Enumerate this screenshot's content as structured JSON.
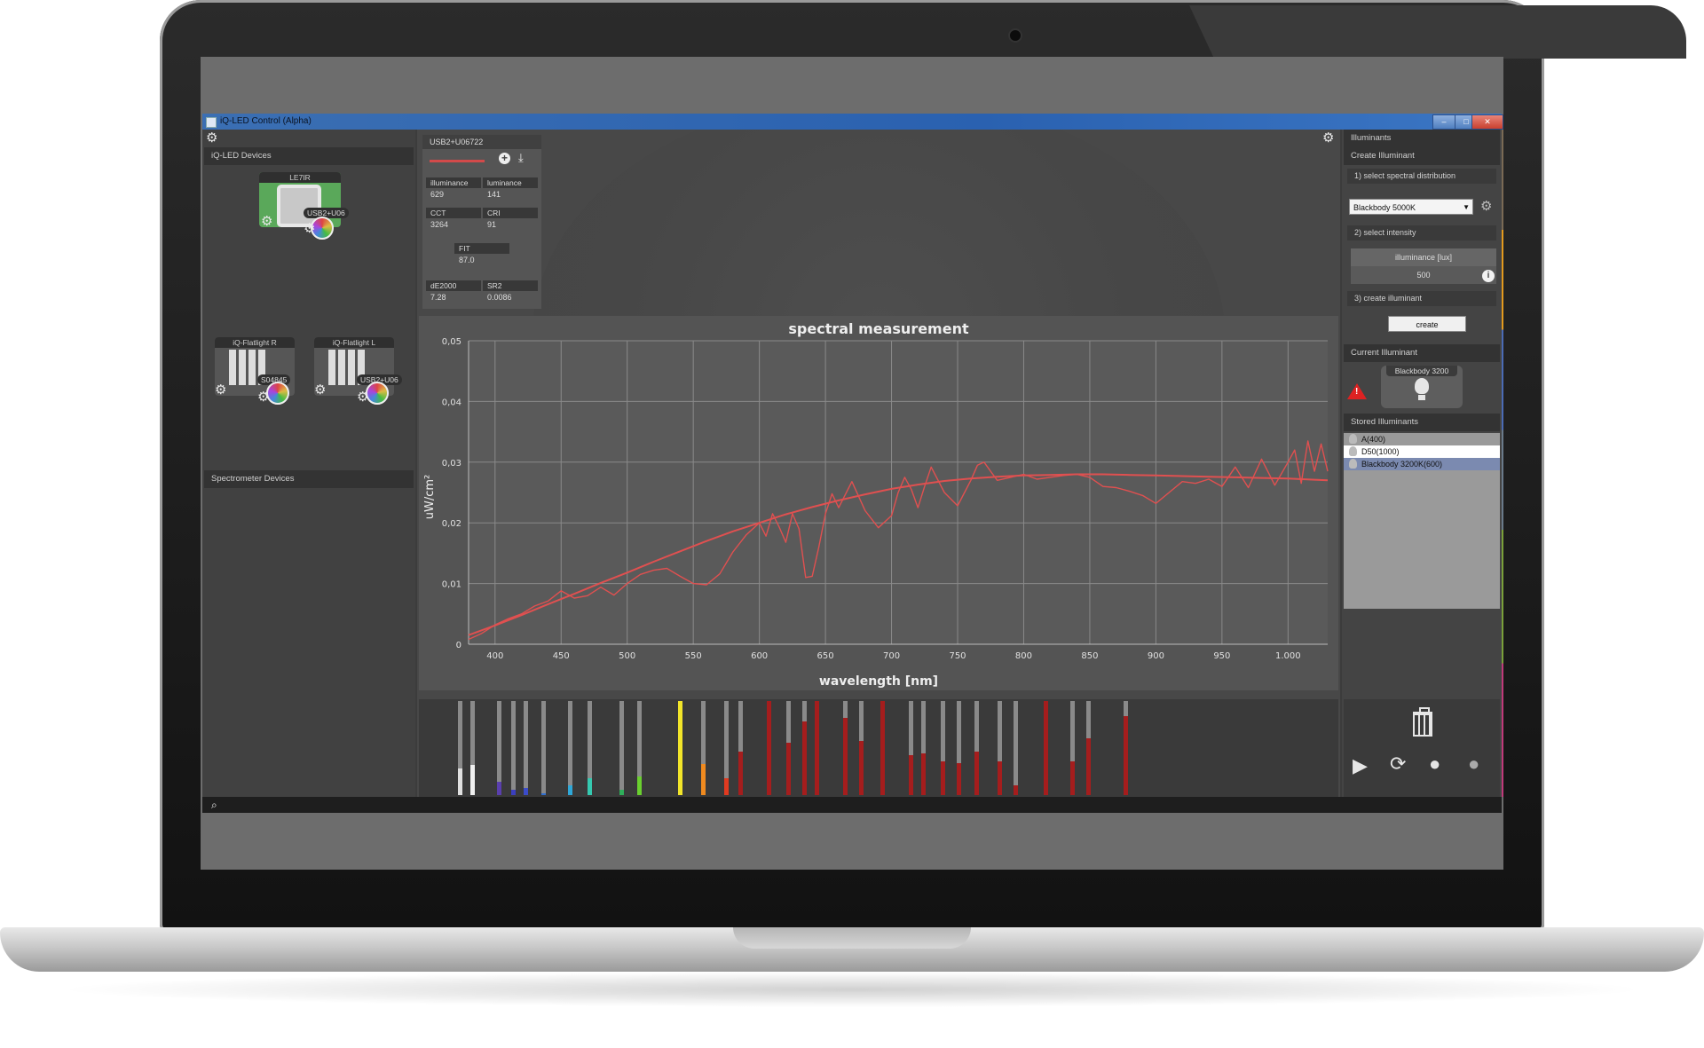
{
  "window": {
    "title": "iQ-LED Control (Alpha)",
    "minimize": "–",
    "maximize": "□",
    "close": "✕"
  },
  "left": {
    "devices_header": "iQ-LED Devices",
    "spectrometer_header": "Spectrometer Devices",
    "devices": [
      {
        "label": "LE7IR",
        "badge": "USB2+U06"
      },
      {
        "label": "iQ-Flatlight R",
        "badge": "S04845"
      },
      {
        "label": "iQ-Flatlight L",
        "badge": "USB2+U06"
      }
    ]
  },
  "measurement": {
    "device": "USB2+U06722",
    "cells": [
      {
        "k": "illuminance",
        "v": "629"
      },
      {
        "k": "luminance",
        "v": "141"
      },
      {
        "k": "CCT",
        "v": "3264"
      },
      {
        "k": "CRI",
        "v": "91"
      },
      {
        "k": "FIT",
        "v": "87.0"
      },
      {
        "k": "dE2000",
        "v": "7.28"
      },
      {
        "k": "SR2",
        "v": "0.0086"
      }
    ]
  },
  "chart_data": {
    "type": "line",
    "title": "spectral measurement",
    "xlabel": "wavelength [nm]",
    "ylabel": "uW/cm²",
    "xlim": [
      380,
      1030
    ],
    "ylim": [
      0,
      0.05
    ],
    "x_ticks": [
      400,
      450,
      500,
      550,
      600,
      650,
      700,
      750,
      800,
      850,
      900,
      950,
      1000
    ],
    "x_tick_labels": [
      "400",
      "450",
      "500",
      "550",
      "600",
      "650",
      "700",
      "750",
      "800",
      "850",
      "900",
      "950",
      "1.000"
    ],
    "y_ticks": [
      0,
      0.01,
      0.02,
      0.03,
      0.04,
      0.05
    ],
    "y_tick_labels": [
      "0",
      "0,01",
      "0,02",
      "0,03",
      "0,04",
      "0,05"
    ],
    "grid": true,
    "line_color": "#e05050",
    "series": [
      {
        "x": [
          380,
          400,
          420,
          440,
          460,
          480,
          500,
          520,
          540,
          560,
          580,
          600,
          620,
          640,
          660,
          680,
          700,
          720,
          740,
          760,
          780,
          800,
          820,
          840,
          860,
          880,
          900,
          920,
          940,
          960,
          980,
          1000,
          1020,
          1030
        ],
        "y": [
          0.0015,
          0.0031,
          0.0048,
          0.0066,
          0.0083,
          0.0101,
          0.0118,
          0.0136,
          0.0153,
          0.017,
          0.0186,
          0.02,
          0.0214,
          0.0226,
          0.0237,
          0.0247,
          0.0256,
          0.0263,
          0.0269,
          0.0273,
          0.0276,
          0.0278,
          0.0279,
          0.028,
          0.028,
          0.0279,
          0.0278,
          0.0277,
          0.0276,
          0.0275,
          0.0274,
          0.0273,
          0.0271,
          0.027
        ]
      },
      {
        "x": [
          380,
          390,
          400,
          410,
          420,
          430,
          440,
          450,
          460,
          470,
          480,
          490,
          500,
          510,
          520,
          530,
          540,
          550,
          560,
          570,
          580,
          590,
          600,
          605,
          610,
          615,
          620,
          625,
          630,
          635,
          640,
          645,
          650,
          655,
          660,
          670,
          680,
          690,
          700,
          705,
          710,
          715,
          720,
          725,
          730,
          740,
          750,
          760,
          765,
          770,
          775,
          780,
          790,
          800,
          810,
          820,
          830,
          840,
          850,
          860,
          870,
          880,
          890,
          900,
          910,
          920,
          930,
          940,
          950,
          960,
          970,
          980,
          990,
          1000,
          1005,
          1010,
          1015,
          1020,
          1025,
          1030
        ],
        "y": [
          0.0008,
          0.0018,
          0.0032,
          0.0042,
          0.005,
          0.0063,
          0.0071,
          0.0088,
          0.0076,
          0.008,
          0.0094,
          0.0081,
          0.01,
          0.0115,
          0.0122,
          0.0125,
          0.0112,
          0.01,
          0.0098,
          0.0116,
          0.0152,
          0.018,
          0.02,
          0.0178,
          0.0215,
          0.0193,
          0.0168,
          0.0215,
          0.019,
          0.011,
          0.0112,
          0.016,
          0.0215,
          0.0248,
          0.0225,
          0.0268,
          0.022,
          0.0192,
          0.0212,
          0.025,
          0.0275,
          0.0255,
          0.0225,
          0.026,
          0.0292,
          0.025,
          0.0228,
          0.027,
          0.0295,
          0.03,
          0.0285,
          0.027,
          0.0275,
          0.028,
          0.0272,
          0.0275,
          0.0278,
          0.028,
          0.0275,
          0.026,
          0.0258,
          0.0252,
          0.0245,
          0.0232,
          0.025,
          0.0268,
          0.0265,
          0.0272,
          0.026,
          0.0292,
          0.0258,
          0.0305,
          0.0262,
          0.03,
          0.032,
          0.0265,
          0.0335,
          0.0285,
          0.033,
          0.0285
        ]
      }
    ]
  },
  "led_channels": [
    {
      "color": "#e0e0e0",
      "level": 0.28
    },
    {
      "color": "#f0f0f0",
      "level": 0.32
    },
    {
      "color": "#5a3fae",
      "level": 0.14
    },
    {
      "color": "#3b3fbf",
      "level": 0.06
    },
    {
      "color": "#3b4cc9",
      "level": 0.08
    },
    {
      "color": "#2f6fd0",
      "level": 0.02
    },
    {
      "color": "#2fa8d8",
      "level": 0.1
    },
    {
      "color": "#35c9b0",
      "level": 0.18
    },
    {
      "color": "#2fae5a",
      "level": 0.06
    },
    {
      "color": "#6ad02f",
      "level": 0.2
    },
    {
      "color": "#f2e52a",
      "level": 1.0
    },
    {
      "color": "#f08a1f",
      "level": 0.33
    },
    {
      "color": "#e03a20",
      "level": 0.18
    },
    {
      "color": "#a51d1d",
      "level": 0.46
    },
    {
      "color": "#a51d1d",
      "level": 1.0
    },
    {
      "color": "#a51d1d",
      "level": 0.56
    },
    {
      "color": "#a51d1d",
      "level": 0.78
    },
    {
      "color": "#a51d1d",
      "level": 1.0
    },
    {
      "color": "#a51d1d",
      "level": 0.82
    },
    {
      "color": "#a51d1d",
      "level": 0.58
    },
    {
      "color": "#a51d1d",
      "level": 1.0
    },
    {
      "color": "#a51d1d",
      "level": 0.42
    },
    {
      "color": "#a51d1d",
      "level": 0.44
    },
    {
      "color": "#a51d1d",
      "level": 0.36
    },
    {
      "color": "#a51d1d",
      "level": 0.34
    },
    {
      "color": "#a51d1d",
      "level": 0.46
    },
    {
      "color": "#a51d1d",
      "level": 0.36
    },
    {
      "color": "#a51d1d",
      "level": 0.1
    },
    {
      "color": "#a51d1d",
      "level": 1.0
    },
    {
      "color": "#a51d1d",
      "level": 0.36
    },
    {
      "color": "#a51d1d",
      "level": 0.6
    },
    {
      "color": "#a51d1d",
      "level": 0.84
    }
  ],
  "right": {
    "header": "Illuminants",
    "create_header": "Create Illuminant",
    "step1": "1) select spectral distribution",
    "spectral_select": "Blackbody 5000K",
    "step2": "2) select intensity",
    "intensity_label": "illuminance [lux]",
    "intensity_value": "500",
    "info": "i",
    "step3": "3) create illuminant",
    "create_button": "create",
    "current_header": "Current Illuminant",
    "current_name": "Blackbody 3200",
    "warning": "!",
    "stored_header": "Stored Illuminants",
    "stored": [
      "A(400)",
      "D50(1000)",
      "Blackbody 3200K(600)"
    ]
  }
}
